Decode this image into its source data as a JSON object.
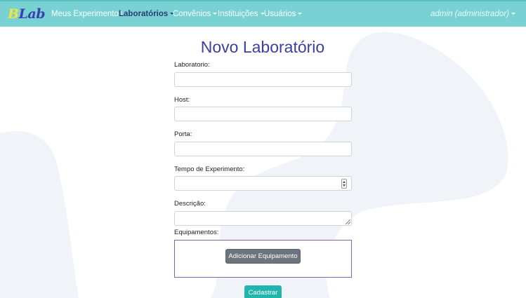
{
  "brand": {
    "part1": "B",
    "part2": "Lab"
  },
  "nav": {
    "items": [
      {
        "label": "Meus Experimentos",
        "dropdown": false,
        "active": false
      },
      {
        "label": "Laboratórios",
        "dropdown": true,
        "active": true
      },
      {
        "label": "Convênios",
        "dropdown": true,
        "active": false
      },
      {
        "label": "Instituições",
        "dropdown": true,
        "active": false
      },
      {
        "label": "Usuários",
        "dropdown": true,
        "active": false
      }
    ],
    "user": "admin (administrador)"
  },
  "page": {
    "title": "Novo Laboratório"
  },
  "form": {
    "laboratorio_label": "Laboratorio:",
    "host_label": "Host:",
    "porta_label": "Porta:",
    "tempo_label": "Tempo de Experimento:",
    "descricao_label": "Descrição:",
    "equipamentos_label": "Equipamentos:",
    "add_equipment_button": "Adicionar Equipamento",
    "submit_button": "Cadastrar"
  },
  "colors": {
    "navbar": "#78d2d4",
    "title": "#3b3fa3",
    "submit": "#20b5ad",
    "secondary": "#6c757d",
    "background_shape": "#f0f3f8"
  }
}
